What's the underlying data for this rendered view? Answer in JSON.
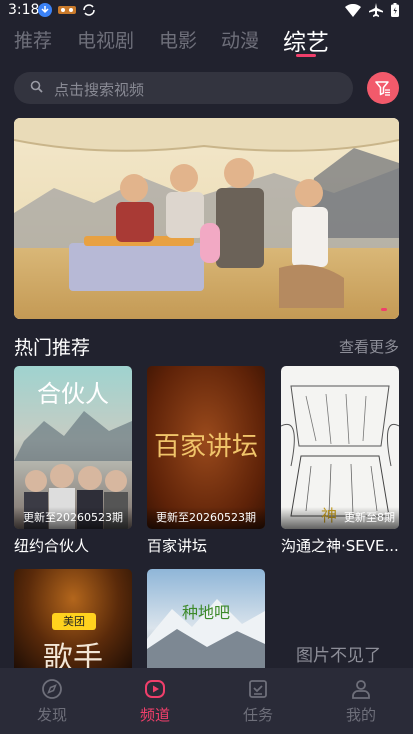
{
  "status": {
    "time": "3:18"
  },
  "tabs": [
    {
      "label": "推荐"
    },
    {
      "label": "电视剧"
    },
    {
      "label": "电影"
    },
    {
      "label": "动漫"
    },
    {
      "label": "综艺"
    }
  ],
  "active_tab": "综艺",
  "search": {
    "placeholder": "点击搜索视频"
  },
  "section": {
    "title": "热门推荐",
    "more": "查看更多"
  },
  "cards": [
    {
      "title": "纽约合伙人",
      "badge": "更新至20260523期",
      "poster_text": "合伙人"
    },
    {
      "title": "百家讲坛",
      "badge": "更新至20260523期",
      "poster_text": "百家讲坛"
    },
    {
      "title": "沟通之神·SEVE...",
      "badge": "更新至8期",
      "poster_text": "神"
    },
    {
      "title": "",
      "badge": "",
      "poster_text": "歌手",
      "poster_brand": "美团"
    },
    {
      "title": "",
      "badge": "",
      "poster_text": "种地吧"
    }
  ],
  "missing_image_text": "图片不见了",
  "bottom_nav": [
    {
      "label": "发现",
      "icon": "compass-icon"
    },
    {
      "label": "频道",
      "icon": "play-icon"
    },
    {
      "label": "任务",
      "icon": "checklist-icon"
    },
    {
      "label": "我的",
      "icon": "user-icon"
    }
  ],
  "active_nav": "频道",
  "colors": {
    "accent": "#f03f6b",
    "background": "#21222e",
    "filter": "#f25a6b"
  }
}
